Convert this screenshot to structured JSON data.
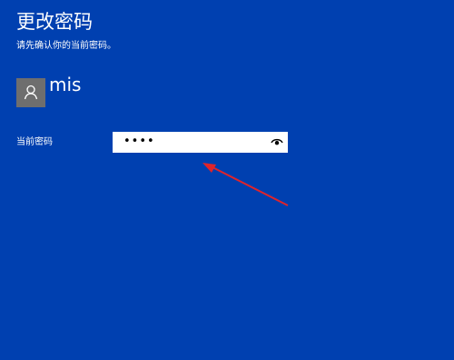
{
  "header": {
    "title": "更改密码",
    "subtitle": "请先确认你的当前密码。"
  },
  "account": {
    "avatar_icon": "user-icon",
    "username": "mis"
  },
  "form": {
    "current_password_label": "当前密码",
    "current_password_value": "••••",
    "reveal_icon": "eye-icon"
  },
  "colors": {
    "background": "#0040b0",
    "avatar": "#6e6e6e",
    "annotation_arrow": "#e0242a"
  }
}
